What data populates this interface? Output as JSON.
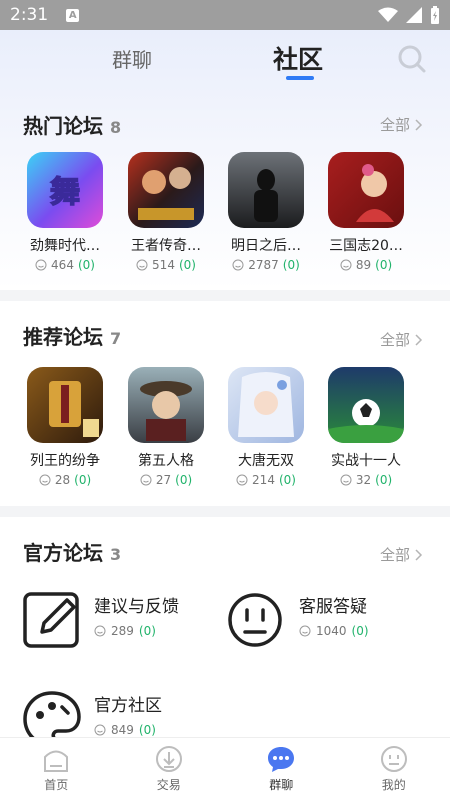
{
  "status_bar": {
    "time": "2:31",
    "notif": "A"
  },
  "top_tabs": {
    "group_chat": "群聊",
    "community": "社区"
  },
  "hot": {
    "title": "热门论坛",
    "count": "8",
    "all": "全部",
    "items": [
      {
        "name": "劲舞时代…",
        "posts": "464",
        "new": "(0)"
      },
      {
        "name": "王者传奇…",
        "posts": "514",
        "new": "(0)"
      },
      {
        "name": "明日之后…",
        "posts": "2787",
        "new": "(0)"
      },
      {
        "name": "三国志20…",
        "posts": "89",
        "new": "(0)"
      }
    ]
  },
  "recommended": {
    "title": "推荐论坛",
    "count": "7",
    "all": "全部",
    "items": [
      {
        "name": "列王的纷争",
        "posts": "28",
        "new": "(0)"
      },
      {
        "name": "第五人格",
        "posts": "27",
        "new": "(0)"
      },
      {
        "name": "大唐无双",
        "posts": "214",
        "new": "(0)"
      },
      {
        "name": "实战十一人",
        "posts": "32",
        "new": "(0)"
      }
    ]
  },
  "official": {
    "title": "官方论坛",
    "count": "3",
    "all": "全部",
    "items": [
      {
        "name": "建议与反馈",
        "posts": "289",
        "new": "(0)"
      },
      {
        "name": "客服答疑",
        "posts": "1040",
        "new": "(0)"
      },
      {
        "name": "官方社区",
        "posts": "849",
        "new": "(0)"
      }
    ]
  },
  "bottom_nav": {
    "home": "首页",
    "trade": "交易",
    "chat": "群聊",
    "mine": "我的"
  },
  "colors": {
    "accent": "#2f7bf5",
    "new_count": "#21b36b",
    "active_tab": "#4a77f0"
  }
}
